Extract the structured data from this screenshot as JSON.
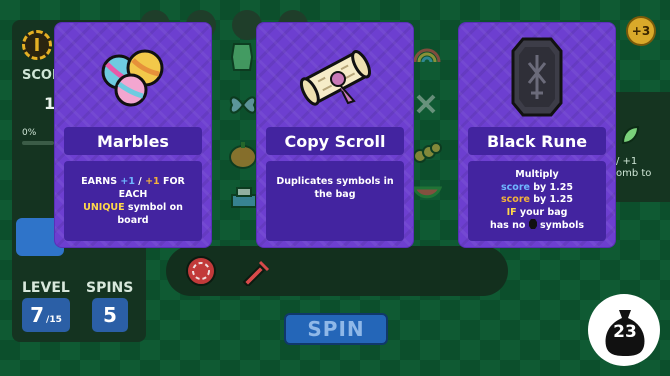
{
  "hud": {
    "coin_symbol": "I",
    "score_label": "SCOR",
    "score_value": "1",
    "percent": "0%",
    "level_label": "LEVEL",
    "level_value": "7",
    "level_total": "/15",
    "spins_label": "SPINS",
    "spins_value": "5"
  },
  "spin_button": {
    "label": "SPIN"
  },
  "right": {
    "plus_badge": "+3",
    "partial_text_1": "/ +1",
    "partial_text_2": "omb to"
  },
  "bag": {
    "count": "23"
  },
  "cards": [
    {
      "title": "Marbles",
      "desc_line1": {
        "earns": "EARNS ",
        "plus_a": "+1",
        "slash": " / ",
        "plus_b": "+1",
        "for_each": " FOR EACH"
      },
      "desc_line2": {
        "unique": "UNIQUE",
        "rest": " symbol on board"
      }
    },
    {
      "title": "Copy Scroll",
      "desc": "Duplicates symbols in the bag"
    },
    {
      "title": "Black Rune",
      "line1": "Multiply",
      "line2_key": "score",
      "line2_rest": " by 1.25",
      "line3_key": "score",
      "line3_rest": " by 1.25",
      "line4_key": "IF",
      "line4_rest": " your bag",
      "line5_pre": "has no ",
      "line5_post": " symbols"
    }
  ],
  "colors": {
    "card_bg": "#6d3fd0",
    "card_panel": "#4324a0",
    "highlight_blue": "#6fb6ff",
    "highlight_cyan": "#4ee0e8",
    "highlight_orange": "#f3b23b",
    "highlight_yellow": "#ffd84a",
    "spin_button": "#2466b8"
  }
}
